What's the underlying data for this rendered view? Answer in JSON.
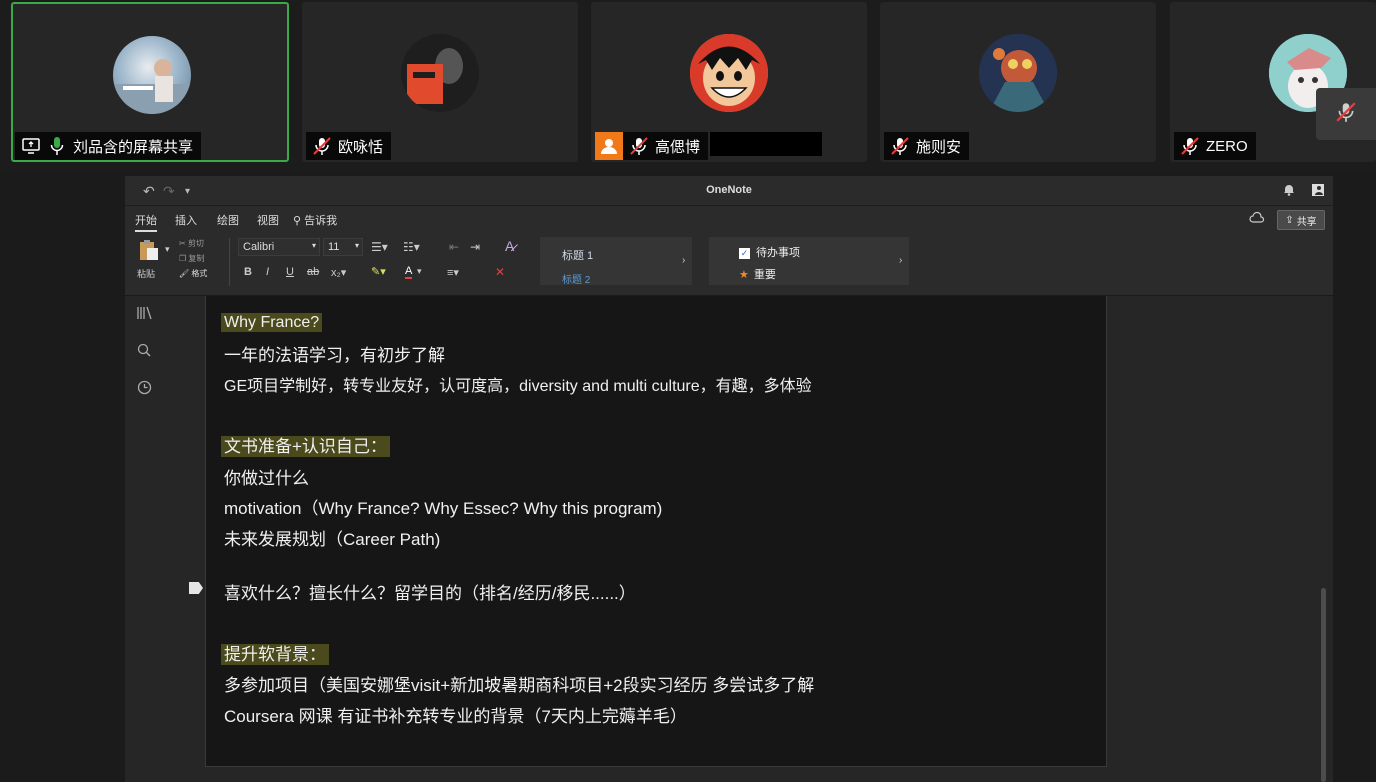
{
  "participants": [
    {
      "name": "刘品含的屏幕共享",
      "mic": "on",
      "sharing": true
    },
    {
      "name": "欧咏恬",
      "mic": "muted"
    },
    {
      "name": "高偲博",
      "mic": "muted",
      "has_person_icon": true
    },
    {
      "name": "施则安",
      "mic": "muted"
    },
    {
      "name": "ZERO",
      "mic": "muted"
    }
  ],
  "window": {
    "title": "OneNote"
  },
  "menu": {
    "tabs": [
      "开始",
      "插入",
      "绘图",
      "视图"
    ],
    "tell_me": "告诉我",
    "share": "共享"
  },
  "ribbon": {
    "paste": "粘贴",
    "cut": "剪切",
    "copy": "复制",
    "format": "格式",
    "font_name": "Calibri",
    "font_size": "11",
    "styles": [
      "标题 1",
      "标题 2"
    ],
    "tags": [
      "待办事项",
      "重要"
    ]
  },
  "note": {
    "lines": [
      {
        "text": "Why France?",
        "heading": true
      },
      {
        "text": "一年的法语学习，有初步了解"
      },
      {
        "text": "GE项目学制好，转专业友好，认可度高，diversity and multi culture，有趣，多体验"
      },
      {
        "text": "文书准备+认识自己：",
        "heading": true
      },
      {
        "text": "你做过什么"
      },
      {
        "text": "motivation（Why France? Why Essec? Why this program)"
      },
      {
        "text": "未来发展规划（Career Path)"
      },
      {
        "text": "喜欢什么？擅长什么？留学目的（排名/经历/移民......）"
      },
      {
        "text": "提升软背景：",
        "heading": true
      },
      {
        "text": "多参加项目（美国安娜堡visit+新加坡暑期商科项目+2段实习经历 多尝试多了解"
      },
      {
        "text": "Coursera 网课 有证书补充转专业的背景（7天内上完薅羊毛）"
      }
    ]
  },
  "colors": {
    "accent_green": "#3aa94a",
    "heading_highlight": "#4a4a1c",
    "person_orange": "#f07a1a",
    "mic_red": "#e04040"
  }
}
